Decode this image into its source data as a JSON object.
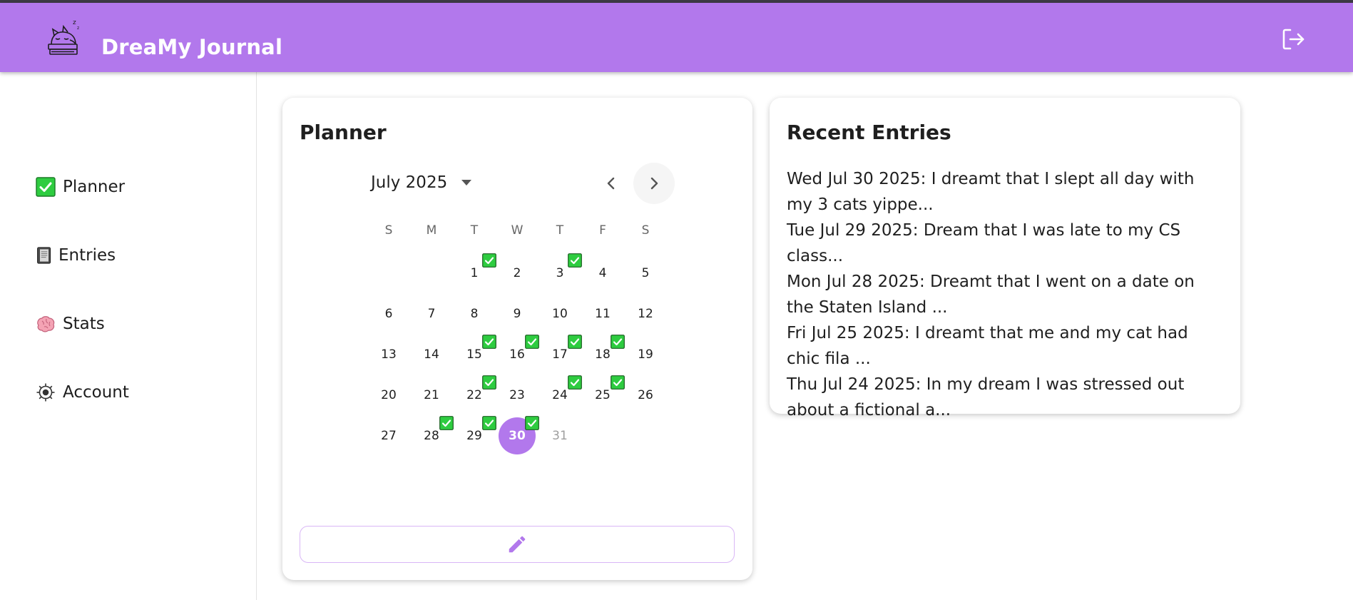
{
  "app": {
    "title": "DreaMy Journal",
    "logo_icon": "cat-sleeping-on-books-logo",
    "logout_icon": "logout-icon",
    "accent_color": "#b278ec"
  },
  "sidebar": {
    "items": [
      {
        "label": "Planner",
        "icon": "checkmark-box-icon"
      },
      {
        "label": "Entries",
        "icon": "notebook-icon"
      },
      {
        "label": "Stats",
        "icon": "brain-icon"
      },
      {
        "label": "Account",
        "icon": "gear-icon"
      }
    ]
  },
  "planner": {
    "title": "Planner",
    "month_label": "July 2025",
    "weekdays": [
      "S",
      "M",
      "T",
      "W",
      "T",
      "F",
      "S"
    ],
    "selected_day": "30",
    "disabled_days": [
      "31"
    ],
    "checked_days": [
      "1",
      "3",
      "15",
      "16",
      "17",
      "18",
      "22",
      "24",
      "25",
      "28",
      "29",
      "30"
    ],
    "days": [
      [
        "",
        "",
        "1",
        "2",
        "3",
        "4",
        "5"
      ],
      [
        "6",
        "7",
        "8",
        "9",
        "10",
        "11",
        "12"
      ],
      [
        "13",
        "14",
        "15",
        "16",
        "17",
        "18",
        "19"
      ],
      [
        "20",
        "21",
        "22",
        "23",
        "24",
        "25",
        "26"
      ],
      [
        "27",
        "28",
        "29",
        "30",
        "31",
        "",
        ""
      ]
    ],
    "edit_icon": "pencil-icon",
    "check_color": "#2ecc40"
  },
  "recent": {
    "title": "Recent Entries",
    "entries": [
      "Wed Jul 30 2025: I dreamt that I slept all day with my 3 cats yippe...",
      "Tue Jul 29 2025: Dream that I was late to my CS class...",
      "Mon Jul 28 2025: Dreamt that I went on a date on the Staten Island ...",
      "Fri Jul 25 2025: I dreamt that me and my cat had chic fila ...",
      "Thu Jul 24 2025: In my dream I was stressed out about a fictional a..."
    ]
  }
}
